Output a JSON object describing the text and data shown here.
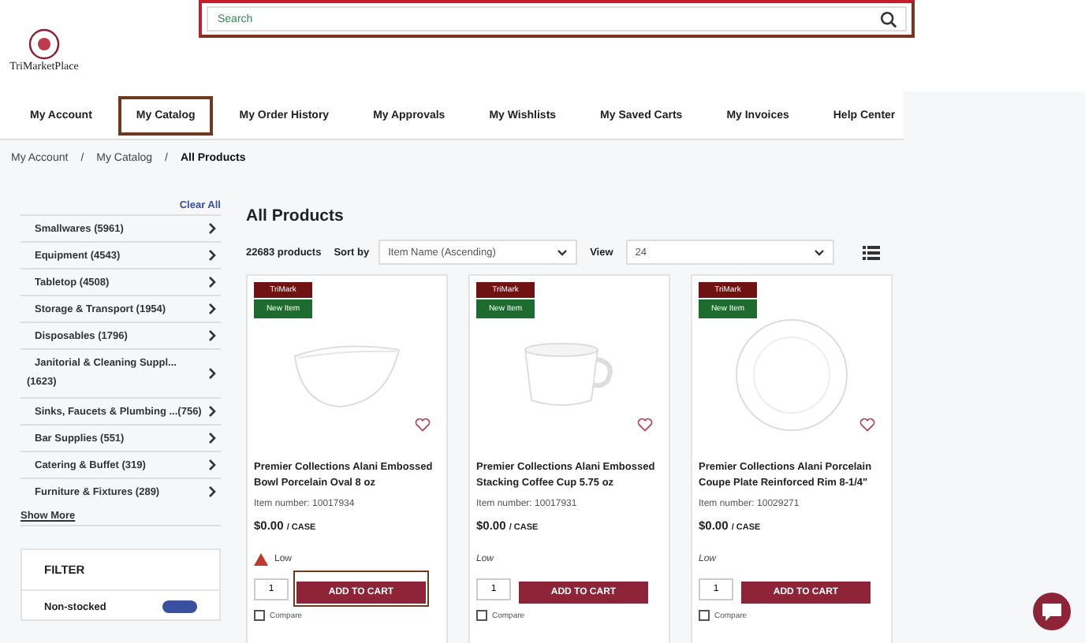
{
  "logo": {
    "text": "TriMarketPlace"
  },
  "search": {
    "placeholder": "Search",
    "highlighted": true
  },
  "nav": [
    {
      "label": "My Account",
      "highlighted": false
    },
    {
      "label": "My Catalog",
      "highlighted": true
    },
    {
      "label": "My Order History",
      "highlighted": false
    },
    {
      "label": "My Approvals",
      "highlighted": false
    },
    {
      "label": "My Wishlists",
      "highlighted": false
    },
    {
      "label": "My Saved Carts",
      "highlighted": false
    },
    {
      "label": "My Invoices",
      "highlighted": false
    },
    {
      "label": "Help Center",
      "highlighted": false
    }
  ],
  "breadcrumb": [
    {
      "label": "My Account"
    },
    {
      "separator": "/",
      "label": "My Catalog"
    },
    {
      "separator": "/",
      "label": "All Products"
    }
  ],
  "sidebar": {
    "clear_all": "Clear All",
    "categories": [
      {
        "label": "Smallwares (5961)"
      },
      {
        "label": "Equipment (4543)"
      },
      {
        "label": "Tabletop (4508)"
      },
      {
        "label": "Storage & Transport (1954)"
      },
      {
        "label": "Disposables (1796)"
      },
      {
        "label": "Janitorial & Cleaning Suppl...",
        "count": "(1623)"
      },
      {
        "label": "Sinks, Faucets & Plumbing ...",
        "count": "(756)"
      },
      {
        "label": "Bar Supplies (551)"
      },
      {
        "label": "Catering & Buffet (319)"
      },
      {
        "label": "Furniture & Fixtures (289)"
      }
    ],
    "show_more": "Show More",
    "filter_title": "FILTER",
    "filter_option": {
      "label": "Non-stocked",
      "on": true
    }
  },
  "title": "All Products",
  "toolbar": {
    "count": "22683 products",
    "sort_label": "Sort by",
    "sort_value": "Item Name (Ascending)",
    "view_label": "View",
    "view_value": "24"
  },
  "products": [
    {
      "brand": "TriMark",
      "badge": "New Item",
      "kind": "bowl",
      "name": "Premier Collections Alani Embossed Bowl Porcelain Oval 8 oz",
      "item_number": "Item number: 10017934",
      "price": "$0.00",
      "unit": "/ CASE",
      "stock": "Low",
      "stock_warning": true,
      "qty": "1",
      "button": "ADD TO CART",
      "highlighted": true,
      "compare": "Compare",
      "compare_checked": false
    },
    {
      "brand": "TriMark",
      "badge": "New Item",
      "kind": "cup",
      "name": "Premier Collections Alani Embossed Stacking Coffee Cup 5.75 oz",
      "item_number": "Item number: 10017931",
      "price": "$0.00",
      "unit": "/ CASE",
      "stock": "Low",
      "stock_warning": false,
      "qty": "1",
      "button": "ADD TO CART",
      "highlighted": false,
      "compare": "Compare",
      "compare_checked": false
    },
    {
      "brand": "TriMark",
      "badge": "New Item",
      "kind": "plate",
      "name": "Premier Collections Alani Porcelain Coupe Plate Reinforced Rim 8-1/4\"",
      "item_number": "Item number: 10029271",
      "price": "$0.00",
      "unit": "/ CASE",
      "stock": "Low",
      "stock_warning": false,
      "qty": "1",
      "button": "ADD TO CART",
      "highlighted": false,
      "compare": "Compare",
      "compare_checked": false
    }
  ]
}
